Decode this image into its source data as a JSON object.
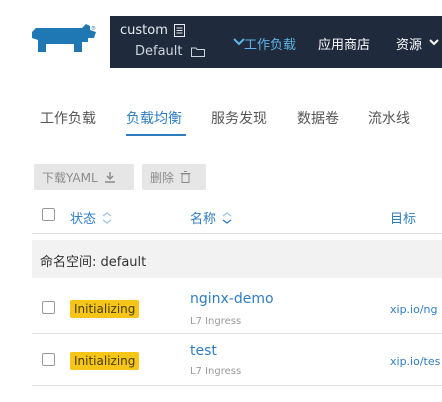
{
  "header": {
    "cluster_name": "custom",
    "project_name": "Default",
    "nav": [
      "工作负载",
      "应用商店",
      "资源"
    ],
    "active_nav": "工作负载"
  },
  "tabs": [
    "工作负载",
    "负载均衡",
    "服务发现",
    "数据卷",
    "流水线"
  ],
  "active_tab": "负载均衡",
  "toolbar": {
    "download_label": "下载YAML",
    "delete_label": "删除"
  },
  "table": {
    "columns": [
      "状态",
      "名称",
      "目标"
    ],
    "namespace_label": "命名空间: default",
    "rows": [
      {
        "status": "Initializing",
        "name": "nginx-demo",
        "type": "L7 Ingress",
        "target": "xip.io/ng"
      },
      {
        "status": "Initializing",
        "name": "test",
        "type": "L7 Ingress",
        "target": "xip.io/tes"
      }
    ]
  },
  "colors": {
    "header_bg": "#1f2b3d",
    "accent": "#2f7dc1",
    "badge": "#f5c518"
  }
}
